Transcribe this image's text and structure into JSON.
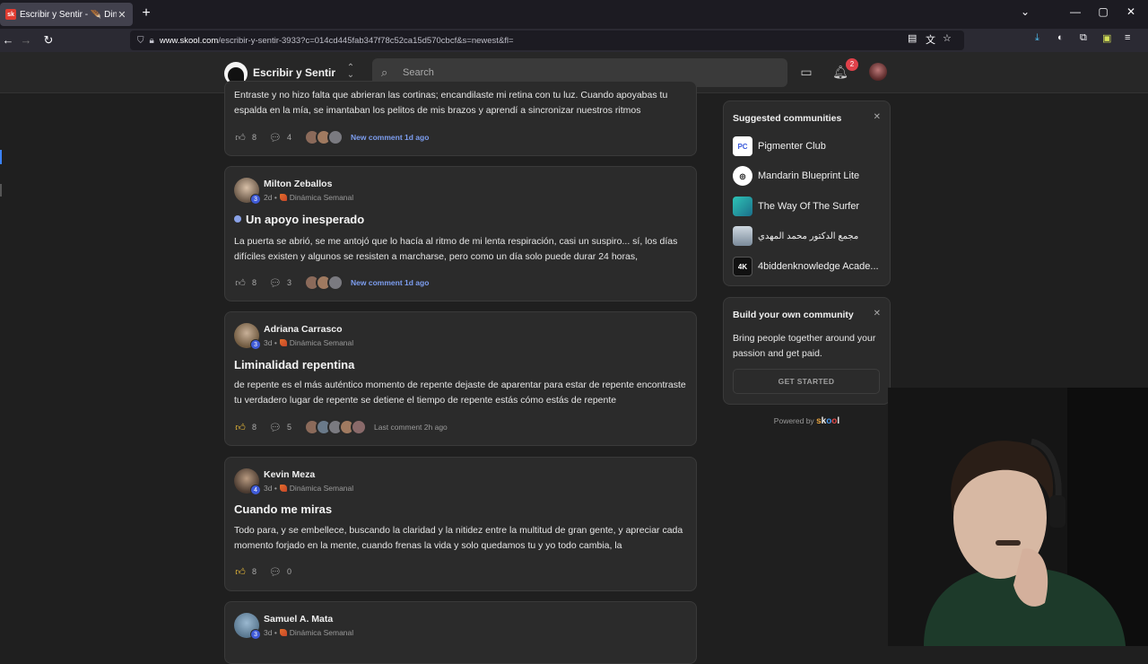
{
  "browser": {
    "tab_title": "Escribir y Sentir - 🪶 Dinámica S",
    "tab_favicon": "sk",
    "url_domain": "www.skool.com",
    "url_path": "/escribir-y-sentir-3933?c=014cd445fab347f78c52ca15d570cbcf&s=newest&fl="
  },
  "header": {
    "community_name": "Escribir y Sentir",
    "search_placeholder": "Search",
    "notification_count": "2"
  },
  "posts": [
    {
      "author": "",
      "time": "",
      "category": "",
      "level": "",
      "title": "",
      "body": "Entraste y no hizo falta que abrieran las cortinas; encandilaste mi retina con tu luz. Cuando apoyabas tu espalda en la mía, se imantaban los pelitos de mis brazos y aprendí a sincronizar nuestros ritmos",
      "likes": "8",
      "comments": "4",
      "activity": "New comment 1d ago"
    },
    {
      "author": "Milton Zeballos",
      "time": "2d •",
      "category": "Dinámica Semanal",
      "level": "3",
      "title": "Un apoyo inesperado",
      "body": "La puerta se abrió, se me antojó que lo hacía al ritmo de mi lenta respiración, casi un suspiro... sí, los días difíciles existen y algunos se resisten a marcharse, pero como un día solo puede durar 24 horas,",
      "likes": "8",
      "comments": "3",
      "activity": "New comment 1d ago"
    },
    {
      "author": "Adriana Carrasco",
      "time": "3d •",
      "category": "Dinámica Semanal",
      "level": "3",
      "title": "Liminalidad repentina",
      "body": "de repente es el más auténtico momento de repente dejaste de aparentar para estar de repente encontraste tu verdadero lugar de repente se detiene el tiempo de repente estás cómo estás de repente",
      "likes": "8",
      "comments": "5",
      "activity": "Last comment 2h ago"
    },
    {
      "author": "Kevin Meza",
      "time": "3d •",
      "category": "Dinámica Semanal",
      "level": "4",
      "title": "Cuando me miras",
      "body": "Todo para, y se embellece, buscando la claridad y la nitidez entre la multitud de gran gente, y apreciar cada momento forjado en la mente, cuando frenas la vida y solo quedamos tu y yo todo cambia, la",
      "likes": "8",
      "comments": "0",
      "activity": ""
    },
    {
      "author": "Samuel A. Mata",
      "time": "3d •",
      "category": "Dinámica Semanal",
      "level": "3",
      "title": "",
      "body": "",
      "likes": "",
      "comments": "",
      "activity": ""
    }
  ],
  "sidebar": {
    "suggested_title": "Suggested communities",
    "communities": [
      {
        "name": "Pigmenter Club",
        "logo": "PC"
      },
      {
        "name": "Mandarin Blueprint Lite",
        "logo": ""
      },
      {
        "name": "The Way Of The Surfer",
        "logo": ""
      },
      {
        "name": "مجمع الدكتور محمد المهدي",
        "logo": ""
      },
      {
        "name": "4biddenknowledge Acade...",
        "logo": "4K"
      }
    ],
    "build_title": "Build your own community",
    "build_text": "Bring people together around your passion and get paid.",
    "get_started": "GET STARTED",
    "powered_by": "Powered by",
    "powered_brand": "skool"
  },
  "colors": {
    "accent_link": "#7d9ef0",
    "level_badge": "#3f5bd8",
    "notification": "#e0414a",
    "liked": "#f4c23a"
  }
}
